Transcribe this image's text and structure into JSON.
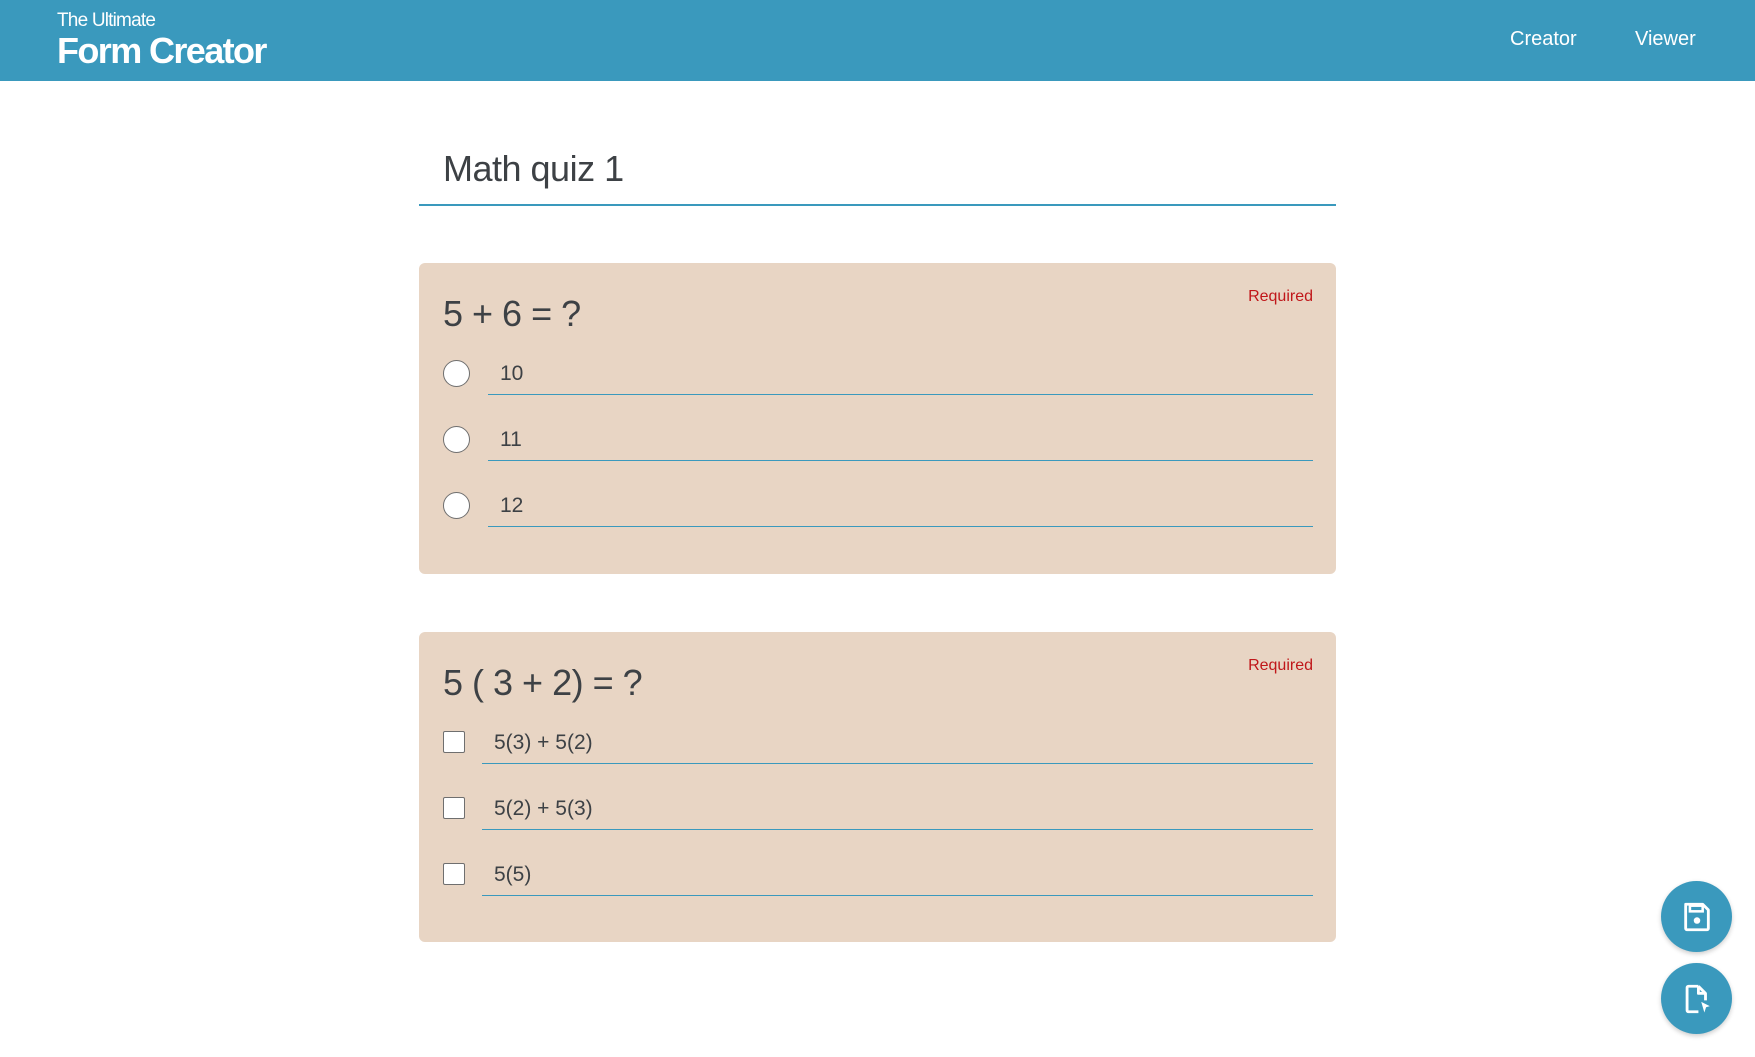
{
  "header": {
    "brand_sub": "The Ultimate",
    "brand_main": "Form Creator",
    "nav": [
      "Creator",
      "Viewer"
    ]
  },
  "form": {
    "title": "Math quiz 1",
    "questions": [
      {
        "text": "5 + 6 = ?",
        "required_label": "Required",
        "type": "radio",
        "options": [
          "10",
          "11",
          "12"
        ]
      },
      {
        "text": "5 ( 3 + 2) = ?",
        "required_label": "Required",
        "type": "checkbox",
        "options": [
          "5(3) + 5(2)",
          "5(2) + 5(3)",
          "5(5)"
        ]
      }
    ]
  },
  "fabs": {
    "save_icon": "save-icon",
    "file_icon": "file-cursor-icon"
  },
  "colors": {
    "primary": "#3a99bd",
    "card_bg": "#e8d5c4",
    "required": "#c0171a"
  }
}
